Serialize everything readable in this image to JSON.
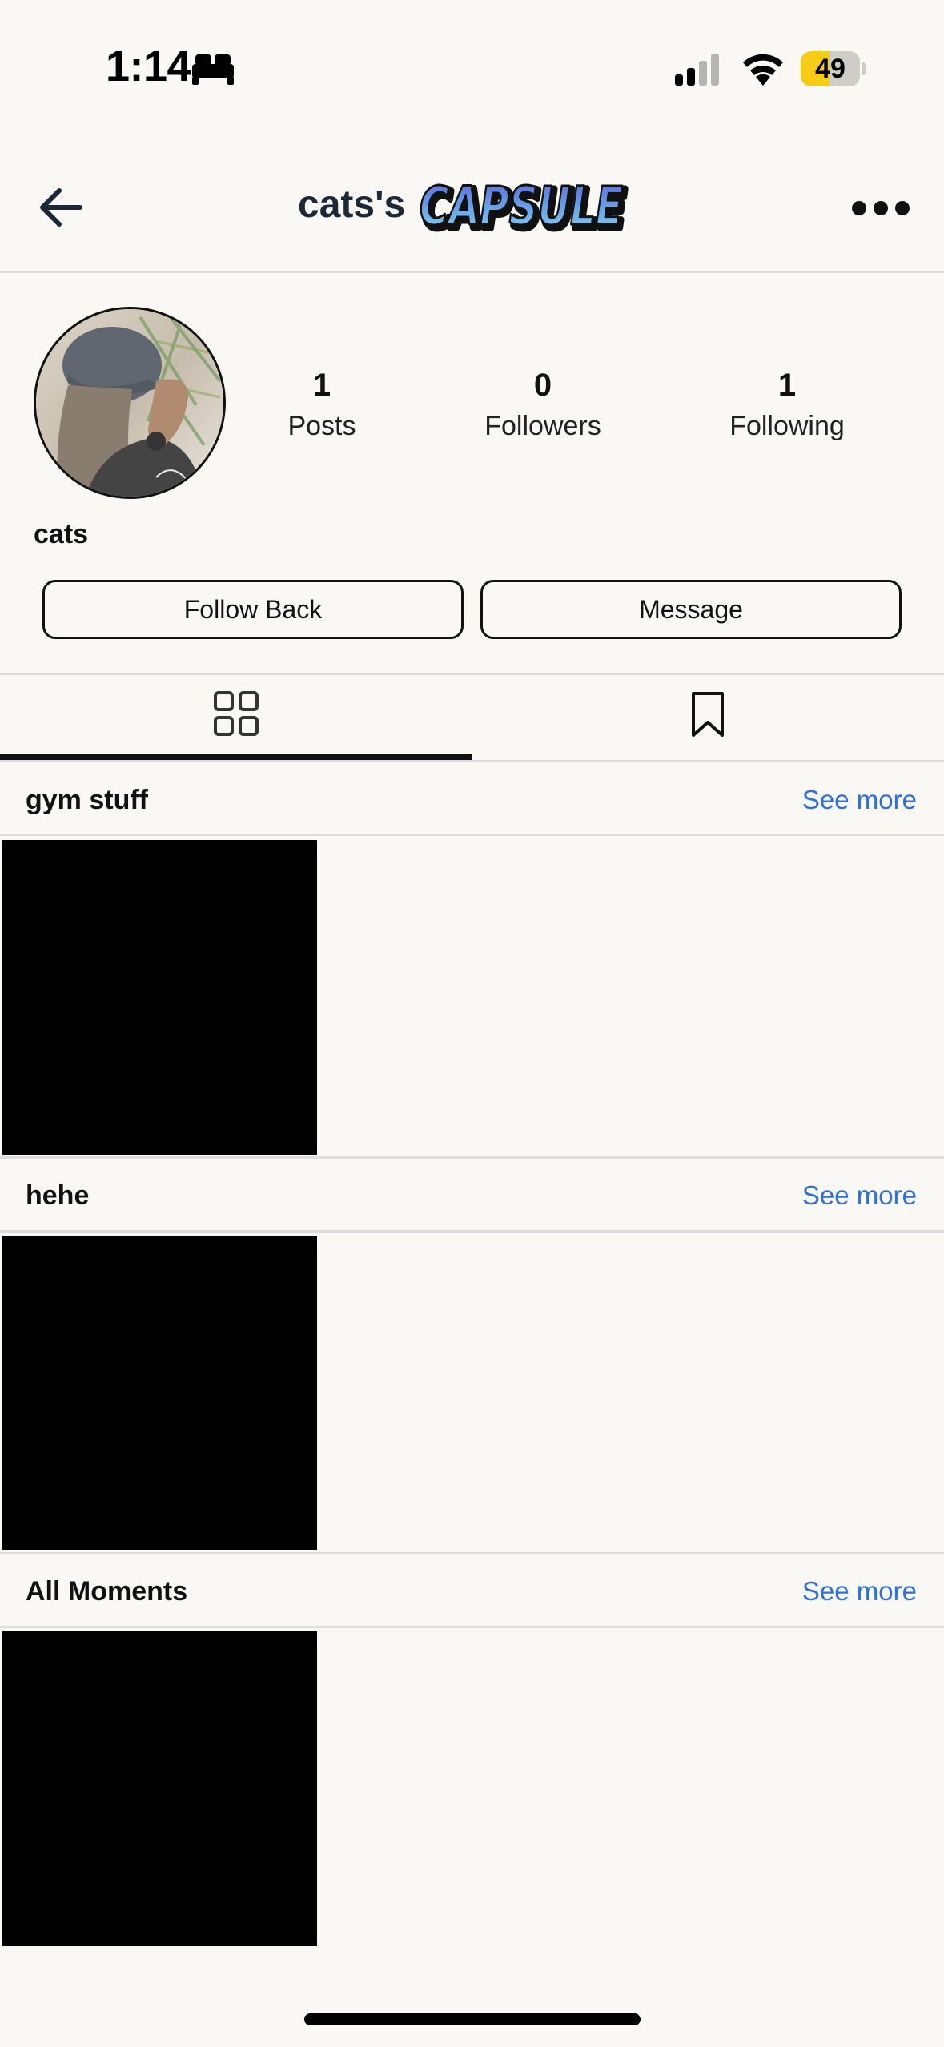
{
  "status_bar": {
    "time": "1:14",
    "battery_percent": "49",
    "battery_level": 0.49,
    "icons": [
      "bed-icon",
      "cellular-signal-icon",
      "wifi-icon",
      "battery-icon"
    ]
  },
  "header": {
    "title": "cats's",
    "logo_name": "capsule-graffiti-logo",
    "logo_text": "CAPSULE"
  },
  "profile": {
    "username": "cats",
    "stats": [
      {
        "value": "1",
        "label": "Posts"
      },
      {
        "value": "0",
        "label": "Followers"
      },
      {
        "value": "1",
        "label": "Following"
      }
    ],
    "follow_back_label": "Follow Back",
    "message_label": "Message"
  },
  "tabs": [
    {
      "icon": "grid-icon",
      "active": true
    },
    {
      "icon": "bookmark-icon",
      "active": false
    }
  ],
  "collections": [
    {
      "title": "gym stuff",
      "see_more": "See more"
    },
    {
      "title": "hehe",
      "see_more": "See more"
    },
    {
      "title": "All Moments",
      "see_more": "See more"
    }
  ],
  "colors": {
    "background": "#f9f8f5",
    "link": "#2f6fd6",
    "battery_fill": "#f7cc16",
    "divider": "#dcdcdc"
  }
}
